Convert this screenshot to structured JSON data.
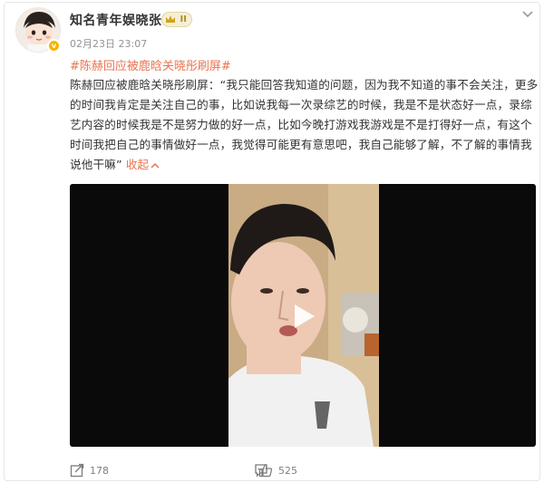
{
  "post": {
    "author": "知名青年娱晓张",
    "level_badge": "II",
    "verified_badge": "v",
    "timestamp": "02月23日 23:07",
    "hashtag": "#陈赫回应被鹿晗关晓彤刷屏#",
    "text_body": "陈赫回应被鹿晗关晓彤刷屏：“我只能回答我知道的问题，因为我不知道的事不会关注，更多的时间我肯定是关注自己的事，比如说我每一次录综艺的时候，我是不是状态好一点，录综艺内容的时候我是不是努力做的好一点，比如今晚打游戏我游戏是不是打得好一点，有这个时间我把自己的事情做好一点，我觉得可能更有意思吧，我自己能够了解，不了解的事情我说他干嘛”",
    "collapse_label": "收起"
  },
  "actions": {
    "share_count": "178",
    "comment_count": "",
    "like_count": "525"
  },
  "colors": {
    "accent": "#eb7350",
    "badge_gold": "#f7b500",
    "video_bg": "#0a0a0a"
  },
  "icons": {
    "more": "chevron-down-icon",
    "share": "share-icon",
    "comment": "comment-icon",
    "like": "like-icon",
    "play": "play-icon"
  }
}
